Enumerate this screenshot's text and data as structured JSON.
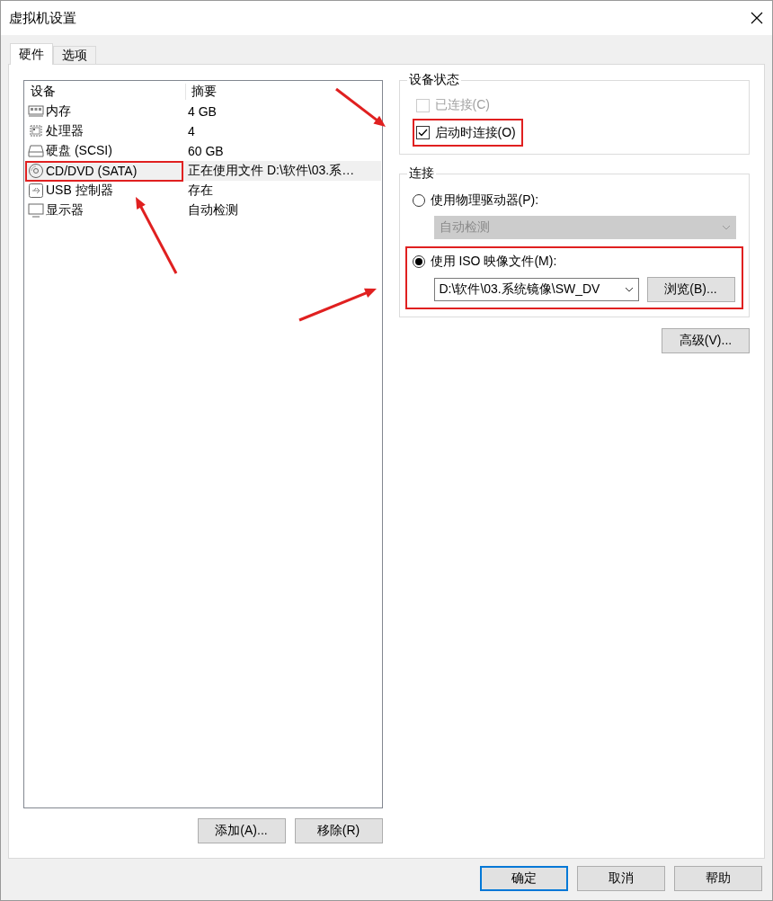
{
  "window": {
    "title": "虚拟机设置"
  },
  "tabs": [
    {
      "label": "硬件",
      "selected": true
    },
    {
      "label": "选项",
      "selected": false
    }
  ],
  "devices": {
    "columns": [
      "设备",
      "摘要"
    ],
    "rows": [
      {
        "kind": "memory",
        "name": "内存",
        "summary": "4 GB",
        "selected": false,
        "highlighted": false
      },
      {
        "kind": "cpu",
        "name": "处理器",
        "summary": "4",
        "selected": false,
        "highlighted": false
      },
      {
        "kind": "disk",
        "name": "硬盘 (SCSI)",
        "summary": "60 GB",
        "selected": false,
        "highlighted": false
      },
      {
        "kind": "cd",
        "name": "CD/DVD (SATA)",
        "summary": "正在使用文件 D:\\软件\\03.系…",
        "selected": true,
        "highlighted": true
      },
      {
        "kind": "usb",
        "name": "USB 控制器",
        "summary": "存在",
        "selected": false,
        "highlighted": false
      },
      {
        "kind": "display",
        "name": "显示器",
        "summary": "自动检测",
        "selected": false,
        "highlighted": false
      }
    ]
  },
  "list_buttons": [
    "添加(A)...",
    "移除(R)"
  ],
  "device_status": {
    "title": "设备状态",
    "checkboxes": [
      {
        "label": "已连接(C)",
        "checked": false,
        "disabled": true,
        "highlighted": false
      },
      {
        "label": "启动时连接(O)",
        "checked": true,
        "disabled": false,
        "highlighted": true
      }
    ]
  },
  "connection": {
    "title": "连接",
    "options": [
      {
        "label": "使用物理驱动器(P):",
        "selected": false,
        "highlighted": false,
        "dropdown": {
          "value": "自动检测",
          "disabled": true
        }
      },
      {
        "label": "使用 ISO 映像文件(M):",
        "selected": true,
        "highlighted": true,
        "dropdown": {
          "value": "D:\\软件\\03.系统镜像\\SW_DV",
          "disabled": false
        },
        "browse": "浏览(B)..."
      }
    ]
  },
  "advanced_button": "高级(V)...",
  "dialog_buttons": [
    {
      "label": "确定",
      "default": true
    },
    {
      "label": "取消",
      "default": false
    },
    {
      "label": "帮助",
      "default": false
    }
  ]
}
